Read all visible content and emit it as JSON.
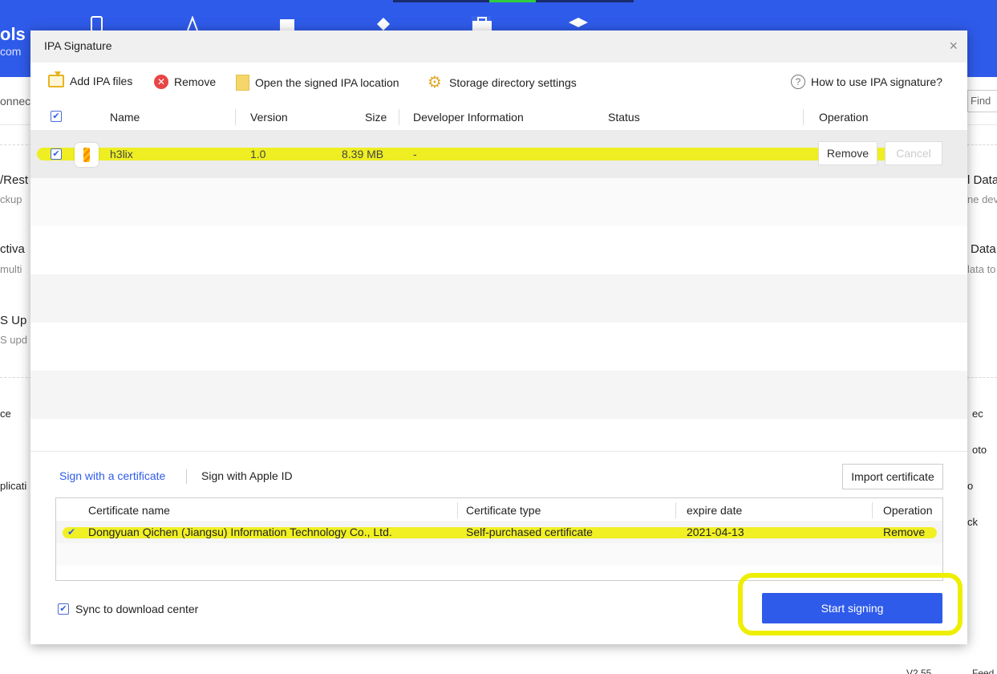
{
  "background": {
    "brand_fragment": "ols",
    "brand_sub_fragment": "com",
    "connect_fragment": "onnect",
    "find_fragment": "Find",
    "left_items": [
      {
        "title": "/Rest",
        "sub": "ckup"
      },
      {
        "title": "ctiva",
        "sub": "multi"
      },
      {
        "title": "S Up",
        "sub": "S upd"
      },
      {
        "title": "ce",
        "sub": ""
      },
      {
        "title": "plicati",
        "sub": ""
      }
    ],
    "right_items": [
      {
        "title": "l Data",
        "sub": "ne dev"
      },
      {
        "title": "Data",
        "sub": "lata to"
      },
      {
        "title": "ec",
        "sub": ""
      },
      {
        "title": "oto",
        "sub": ""
      },
      {
        "title": "o",
        "sub": ""
      },
      {
        "title": "ck",
        "sub": ""
      }
    ],
    "version": "V2.55",
    "feedback_fragment": "Feed"
  },
  "dialog": {
    "title": "IPA Signature",
    "close_glyph": "×",
    "toolbar": {
      "add": "Add IPA files",
      "remove": "Remove",
      "open_location": "Open the signed IPA location",
      "storage_settings": "Storage directory settings",
      "help": "How to use IPA signature?"
    },
    "table": {
      "headers": {
        "name": "Name",
        "version": "Version",
        "size": "Size",
        "developer": "Developer Information",
        "status": "Status",
        "operation": "Operation"
      },
      "rows": [
        {
          "checked": true,
          "name": "h3lix",
          "version": "1.0",
          "size": "8.39 MB",
          "developer": "-",
          "status": "",
          "remove_label": "Remove",
          "cancel_label": "Cancel"
        }
      ]
    },
    "tabs": {
      "certificate": "Sign with a certificate",
      "apple_id": "Sign with Apple ID"
    },
    "import_certificate": "Import certificate",
    "cert_table": {
      "headers": {
        "name": "Certificate name",
        "type": "Certificate type",
        "expire": "expire date",
        "operation": "Operation"
      },
      "rows": [
        {
          "selected": true,
          "name": "Dongyuan Qichen (Jiangsu) Information Technology Co., Ltd.",
          "type": "Self-purchased certificate",
          "expire": "2021-04-13",
          "operation": "Remove"
        }
      ]
    },
    "sync_label": "Sync to download center",
    "sync_checked": true,
    "start_button": "Start signing"
  },
  "colors": {
    "brand_blue": "#2f5bea",
    "highlight_yellow": "#eeee00"
  }
}
